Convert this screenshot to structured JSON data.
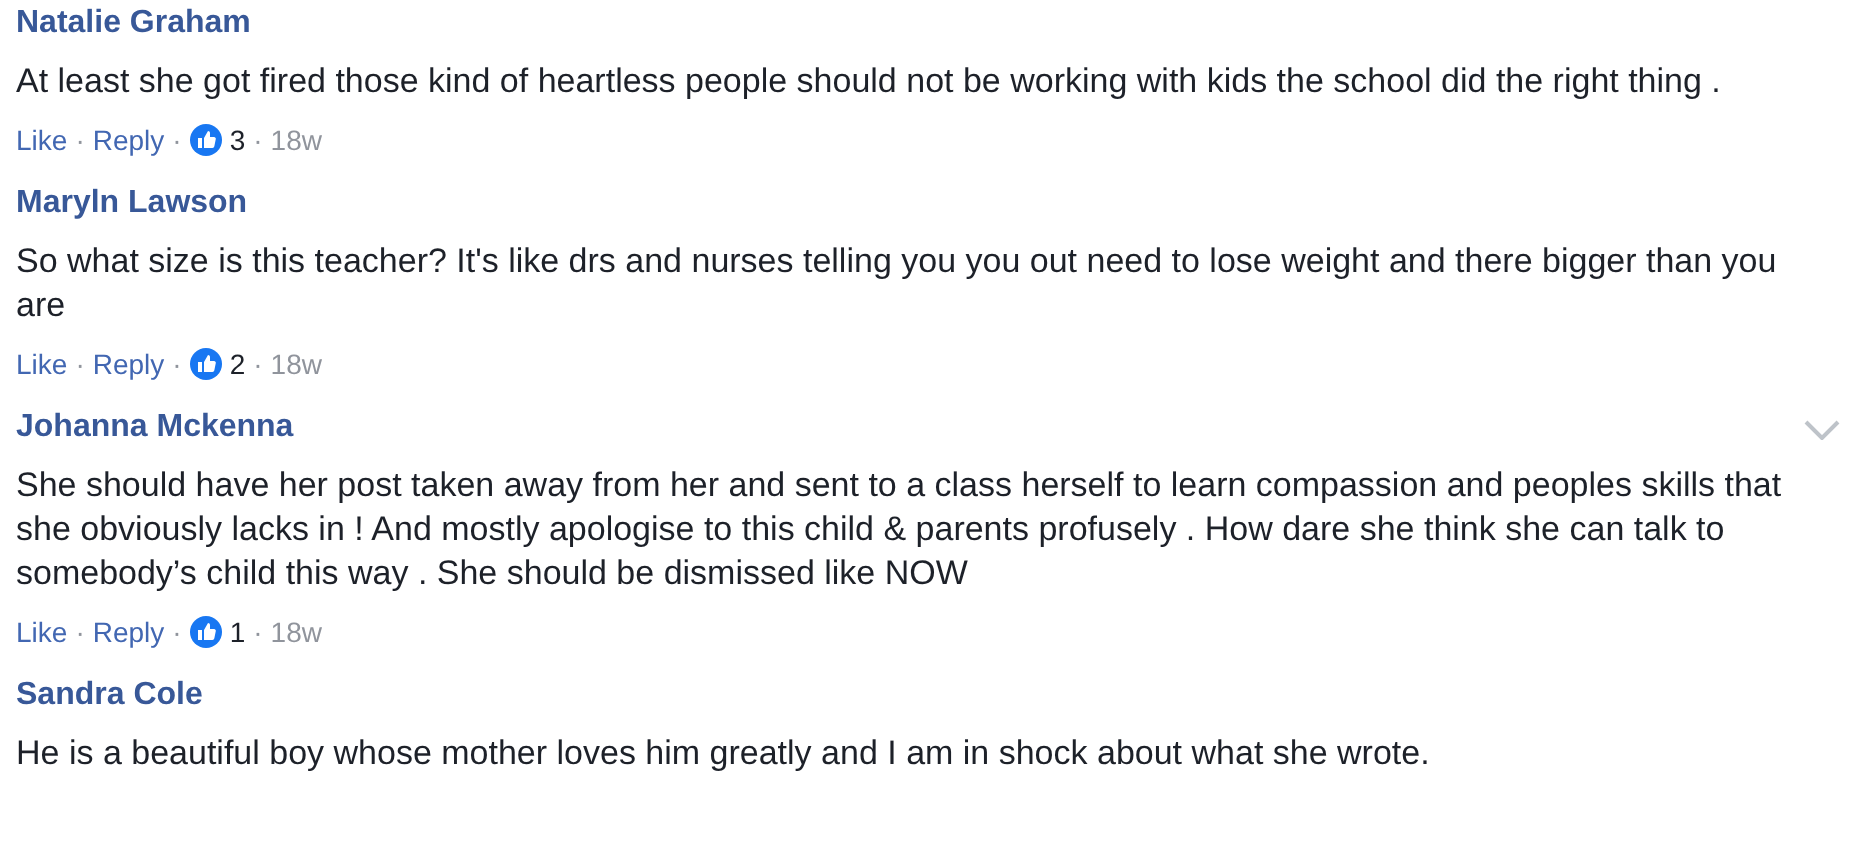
{
  "separator": "·",
  "comments": [
    {
      "author": "Natalie Graham",
      "text": "At least she got fired those kind of heartless people should not be working with kids the school did the right thing .",
      "actions": [
        "Like",
        "Reply"
      ],
      "likes": "3",
      "age": "18w",
      "options_shown": false
    },
    {
      "author": "Maryln Lawson",
      "text": "So what size is this teacher? It's like drs and nurses telling you you out need to lose weight and there bigger than you are",
      "actions": [
        "Like",
        "Reply"
      ],
      "likes": "2",
      "age": "18w",
      "options_shown": false
    },
    {
      "author": "Johanna Mckenna",
      "text": "She should have her post taken away from her and sent to a class herself to learn compassion and peoples skills that she obviously lacks in ! And mostly apologise to this child & parents profusely . How dare she think she can talk to somebody’s child this way . She should be dismissed like NOW",
      "actions": [
        "Like",
        "Reply"
      ],
      "likes": "1",
      "age": "18w",
      "options_shown": true
    },
    {
      "author": "Sandra Cole",
      "text": "He is a beautiful boy whose mother loves him greatly and I am in shock about what she wrote."
    }
  ]
}
